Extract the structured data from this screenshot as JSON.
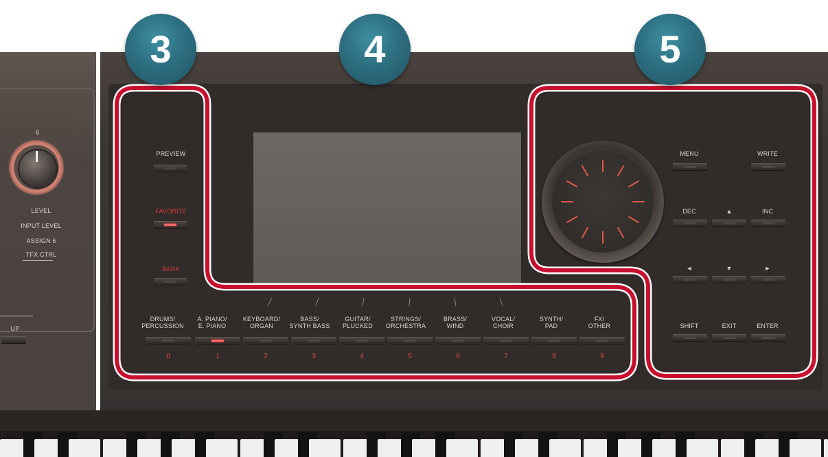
{
  "callouts": [
    {
      "number": "3"
    },
    {
      "number": "4"
    },
    {
      "number": "5"
    }
  ],
  "left_panel": {
    "knob_label": "6",
    "labels": [
      "LEVEL",
      "INPUT LEVEL",
      "ASSIGN 6",
      "TFX CTRL"
    ],
    "side_button_label": "UP"
  },
  "section3": {
    "preview": "PREVIEW",
    "favorite": "FAVORITE",
    "bank": "BANK"
  },
  "category_buttons": [
    {
      "label": "DRUMS/\nPERCUSSION",
      "number": "0"
    },
    {
      "label": "A. PIANO/\nE. PIANO",
      "number": "1"
    },
    {
      "label": "KEYBOARD/\nORGAN",
      "number": "2"
    },
    {
      "label": "BASS/\nSYNTH BASS",
      "number": "3"
    },
    {
      "label": "GUITAR/\nPLUCKED",
      "number": "4"
    },
    {
      "label": "STRINGS/\nORCHESTRA",
      "number": "5"
    },
    {
      "label": "BRASS/\nWIND",
      "number": "6"
    },
    {
      "label": "VOCAL/\nCHOIR",
      "number": "7"
    },
    {
      "label": "SYNTH/\nPAD",
      "number": "8"
    },
    {
      "label": "FX/\nOTHER",
      "number": "9"
    }
  ],
  "section5": {
    "menu": "MENU",
    "write": "WRITE",
    "dec": "DEC",
    "up": "▲",
    "inc": "INC",
    "left": "◄",
    "down": "▼",
    "right": "►",
    "shift": "SHIFT",
    "exit": "EXIT",
    "enter": "ENTER"
  },
  "colors": {
    "callout_badge": "#2d6f81",
    "highlight_outline": "#c8102e",
    "led_on": "#ff6a6a",
    "label_red": "#d93a3a",
    "panel": "#3a3431"
  }
}
